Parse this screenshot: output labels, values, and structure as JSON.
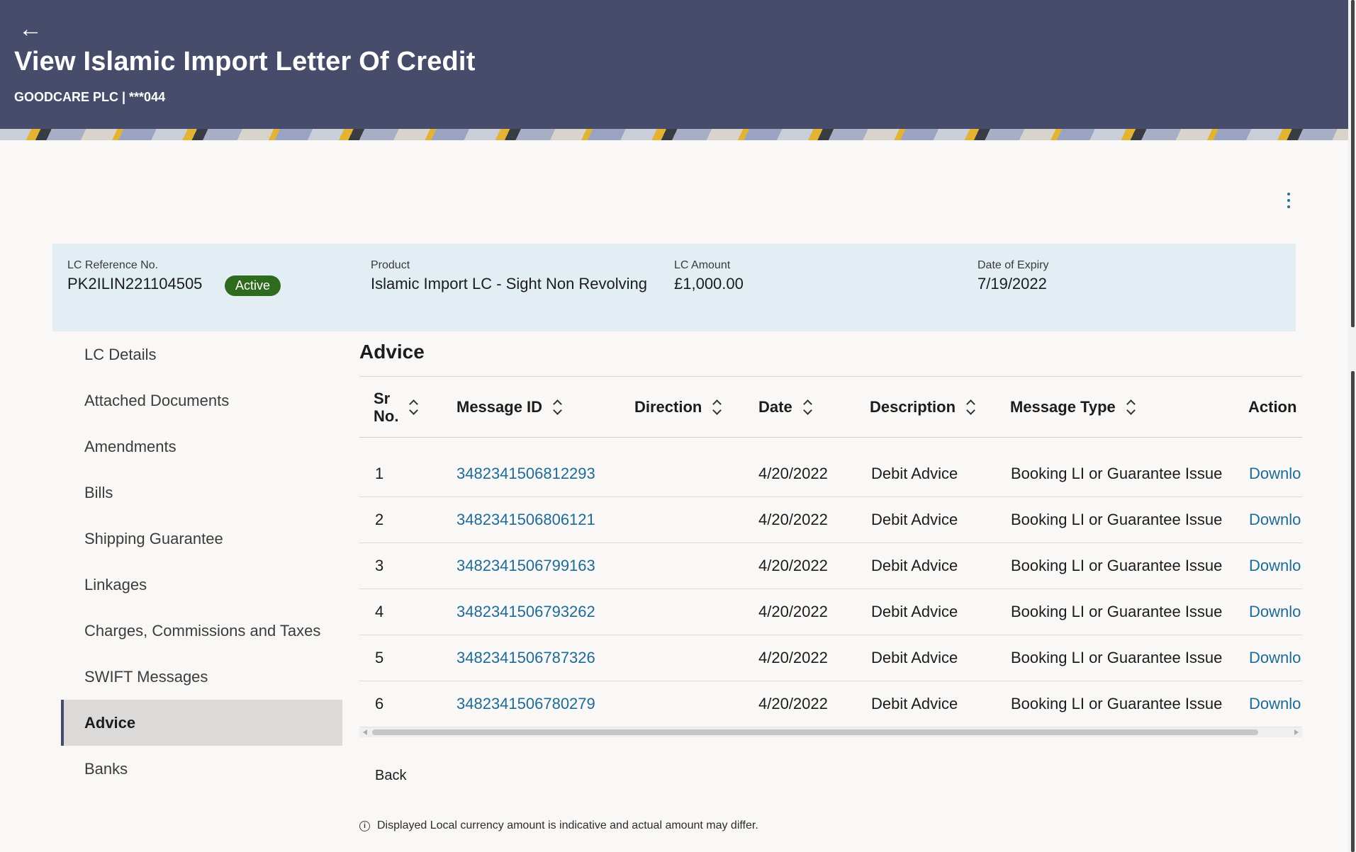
{
  "header": {
    "title": "View Islamic Import Letter Of Credit",
    "subtitle": "GOODCARE PLC | ***044",
    "back_icon": "←"
  },
  "summary": {
    "ref_label": "LC Reference No.",
    "ref_value": "PK2ILIN221104505",
    "status": "Active",
    "product_label": "Product",
    "product_value": "Islamic Import LC - Sight Non Revolving",
    "amount_label": "LC Amount",
    "amount_value": "£1,000.00",
    "expiry_label": "Date of Expiry",
    "expiry_value": "7/19/2022"
  },
  "sidebar": {
    "items": [
      {
        "label": "LC Details"
      },
      {
        "label": "Attached Documents"
      },
      {
        "label": "Amendments"
      },
      {
        "label": "Bills"
      },
      {
        "label": "Shipping Guarantee"
      },
      {
        "label": "Linkages"
      },
      {
        "label": "Charges, Commissions and Taxes"
      },
      {
        "label": "SWIFT Messages"
      },
      {
        "label": "Advice"
      },
      {
        "label": "Banks"
      }
    ],
    "active": "Advice"
  },
  "advice": {
    "title": "Advice",
    "columns": {
      "sr": "Sr No.",
      "sr_line1": "Sr",
      "sr_line2": "No.",
      "message_id": "Message ID",
      "direction": "Direction",
      "date": "Date",
      "description": "Description",
      "message_type": "Message Type",
      "action": "Action"
    },
    "rows": [
      {
        "sr": "1",
        "message_id": "3482341506812293",
        "direction": "",
        "date": "4/20/2022",
        "description": "Debit Advice",
        "message_type": "Booking LI or Guarantee Issue",
        "action": "Downlo"
      },
      {
        "sr": "2",
        "message_id": "3482341506806121",
        "direction": "",
        "date": "4/20/2022",
        "description": "Debit Advice",
        "message_type": "Booking LI or Guarantee Issue",
        "action": "Downlo"
      },
      {
        "sr": "3",
        "message_id": "3482341506799163",
        "direction": "",
        "date": "4/20/2022",
        "description": "Debit Advice",
        "message_type": "Booking LI or Guarantee Issue",
        "action": "Downlo"
      },
      {
        "sr": "4",
        "message_id": "3482341506793262",
        "direction": "",
        "date": "4/20/2022",
        "description": "Debit Advice",
        "message_type": "Booking LI or Guarantee Issue",
        "action": "Downlo"
      },
      {
        "sr": "5",
        "message_id": "3482341506787326",
        "direction": "",
        "date": "4/20/2022",
        "description": "Debit Advice",
        "message_type": "Booking LI or Guarantee Issue",
        "action": "Downlo"
      },
      {
        "sr": "6",
        "message_id": "3482341506780279",
        "direction": "",
        "date": "4/20/2022",
        "description": "Debit Advice",
        "message_type": "Booking LI or Guarantee Issue",
        "action": "Downlo"
      }
    ]
  },
  "footer": {
    "back_label": "Back",
    "note": "Displayed Local currency amount is indicative and actual amount may differ.",
    "info_icon": "i"
  },
  "colors": {
    "header_bg": "#474c6a",
    "summary_bg": "#e3eef4",
    "link": "#1d6b96",
    "badge": "#2e6b1e"
  }
}
